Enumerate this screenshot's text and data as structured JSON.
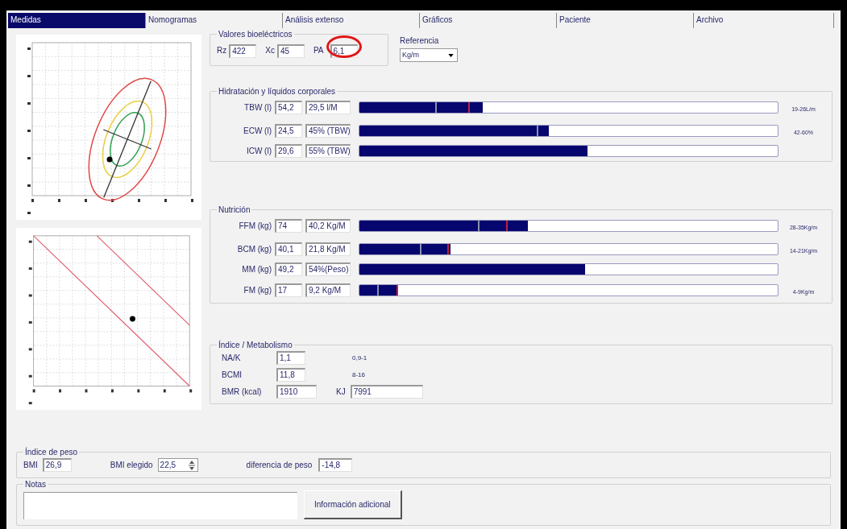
{
  "tabs": [
    {
      "label": "Medidas",
      "selected": true
    },
    {
      "label": "Nomogramas",
      "selected": false
    },
    {
      "label": "Análisis extenso",
      "selected": false
    },
    {
      "label": "Gráficos",
      "selected": false
    },
    {
      "label": "Paciente",
      "selected": false
    },
    {
      "label": "Archivo",
      "selected": false
    }
  ],
  "bioelectric": {
    "title": "Valores bioeléctricos",
    "fields": [
      {
        "label": "Rz",
        "value": "422",
        "highlighted": false
      },
      {
        "label": "Xc",
        "value": "45",
        "highlighted": false
      },
      {
        "label": "PA",
        "value": "6,1",
        "highlighted": true
      }
    ]
  },
  "reference": {
    "label": "Referencia",
    "value": "Kg/m"
  },
  "hydration": {
    "title": "Hidratación y líquidos corporales",
    "rows": [
      {
        "label": "TBW (l)",
        "value": "54,2",
        "derived": "29,5 l/M",
        "level": 0.295,
        "range": "19-26L/m",
        "markers": [
          {
            "level": 0.182,
            "color": "#8a90b0"
          },
          {
            "level": 0.26,
            "color": "#c02040"
          }
        ]
      },
      {
        "label": "ECW (l)",
        "value": "24,5",
        "derived": "45% (TBW)",
        "level": 0.453,
        "range": "42-60%",
        "markers": [
          {
            "level": 0.424,
            "color": "#8a90b0"
          }
        ]
      },
      {
        "label": "ICW (l)",
        "value": "29,6",
        "derived": "55% (TBW)",
        "level": 0.546,
        "markers": []
      }
    ]
  },
  "nutrition": {
    "title": "Nutrición",
    "rows": [
      {
        "label": "FFM (kg)",
        "value": "74",
        "derived": "40,2 Kg/M",
        "level": 0.402,
        "range": "28-35Kg/m",
        "markers": [
          {
            "level": 0.284,
            "color": "#8a90b0"
          },
          {
            "level": 0.35,
            "color": "#c02040"
          }
        ]
      },
      {
        "label": "BCM (kg)",
        "value": "40,1",
        "derived": "21,8 Kg/M",
        "level": 0.218,
        "range": "14-21Kg/m",
        "markers": [
          {
            "level": 0.144,
            "color": "#8a90b0"
          },
          {
            "level": 0.21,
            "color": "#c02040"
          }
        ]
      },
      {
        "label": "MM (kg)",
        "value": "49,2",
        "derived": "54%(Peso)",
        "level": 0.54,
        "markers": []
      },
      {
        "label": "FM (kg)",
        "value": "17",
        "derived": "9,2 Kg/M",
        "level": 0.092,
        "range": "4-9Kg/m",
        "markers": [
          {
            "level": 0.043,
            "color": "#8a90b0"
          },
          {
            "level": 0.089,
            "color": "#c02040"
          }
        ]
      }
    ]
  },
  "metabolism": {
    "title": "Índice / Metabolismo",
    "rows": [
      {
        "label": "NA/K",
        "value": "1,1",
        "note": "0,9-1"
      },
      {
        "label": "BCMI",
        "value": "11,8",
        "note": "8-16"
      },
      {
        "label": "BMR (kcal)",
        "value": "1910",
        "extra_label": "KJ",
        "extra_value": "7991"
      }
    ]
  },
  "weight_index": {
    "title": "Índice de peso",
    "bmi_label": "BMI",
    "bmi": "26,9",
    "chosen_label": "BMI elegido",
    "chosen": "22,5",
    "diff_label": "diferencia de peso",
    "diff": "-14,8"
  },
  "notes": {
    "title": "Notas",
    "button": "Información adicional"
  }
}
